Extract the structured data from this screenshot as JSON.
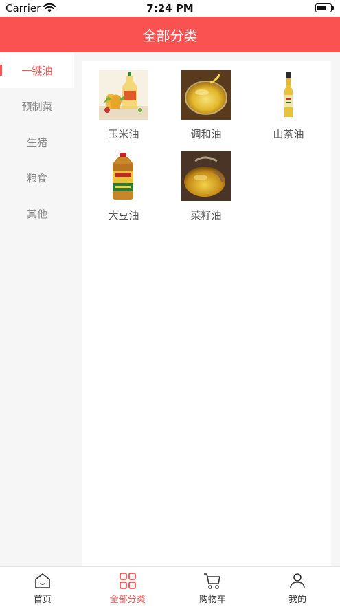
{
  "status_bar": {
    "carrier": "Carrier",
    "time": "7:24 PM"
  },
  "header": {
    "title": "全部分类"
  },
  "sidebar": {
    "items": [
      {
        "label": "一键油",
        "active": true
      },
      {
        "label": "预制菜",
        "active": false
      },
      {
        "label": "生猪",
        "active": false
      },
      {
        "label": "粮食",
        "active": false
      },
      {
        "label": "其他",
        "active": false
      }
    ]
  },
  "products": [
    {
      "name": "玉米油",
      "icon": "corn-oil-image"
    },
    {
      "name": "调和油",
      "icon": "blended-oil-image"
    },
    {
      "name": "山茶油",
      "icon": "camellia-oil-image"
    },
    {
      "name": "大豆油",
      "icon": "soybean-oil-image"
    },
    {
      "name": "菜籽油",
      "icon": "rapeseed-oil-image"
    }
  ],
  "tabbar": {
    "items": [
      {
        "label": "首页",
        "icon": "home-icon",
        "active": false
      },
      {
        "label": "全部分类",
        "icon": "categories-grid-icon",
        "active": true
      },
      {
        "label": "购物车",
        "icon": "cart-icon",
        "active": false
      },
      {
        "label": "我的",
        "icon": "user-icon",
        "active": false
      }
    ]
  },
  "colors": {
    "accent": "#fa5151",
    "sidebar_bg": "#f6f6f6",
    "text_secondary": "#888888"
  }
}
